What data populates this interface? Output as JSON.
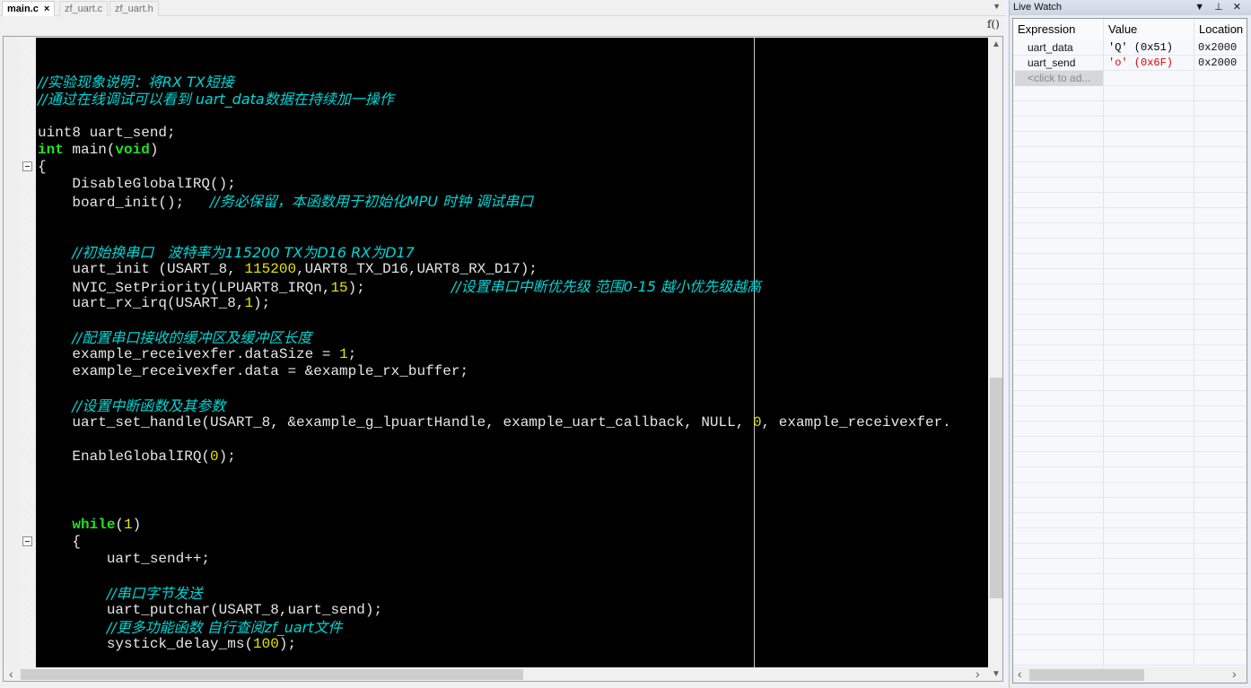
{
  "tabs": [
    {
      "label": "main.c",
      "active": true,
      "close_icon": "×"
    },
    {
      "label": "zf_uart.c",
      "active": false
    },
    {
      "label": "zf_uart.h",
      "active": false
    }
  ],
  "toolbar": {
    "tab_dropdown_icon": "▼",
    "function_icon": "f()"
  },
  "editor": {
    "lines": [
      {
        "segments": [
          {
            "t": "//实验现象说明：将RX TX短接",
            "c": "cm"
          }
        ]
      },
      {
        "segments": [
          {
            "t": "//通过在线调试可以看到 uart_data数据在持续加一操作",
            "c": "cm"
          }
        ]
      },
      {
        "segments": []
      },
      {
        "segments": [
          {
            "t": "uint8 uart_send;",
            "c": ""
          }
        ]
      },
      {
        "segments": [
          {
            "t": "int",
            "c": "kw"
          },
          {
            "t": " main(",
            "c": ""
          },
          {
            "t": "void",
            "c": "kw"
          },
          {
            "t": ")",
            "c": ""
          }
        ]
      },
      {
        "segments": [
          {
            "t": "{",
            "c": ""
          }
        ],
        "fold": true
      },
      {
        "segments": [
          {
            "t": "    DisableGlobalIRQ();",
            "c": ""
          }
        ]
      },
      {
        "segments": [
          {
            "t": "    board_init();   ",
            "c": ""
          },
          {
            "t": "//务必保留，本函数用于初始化MPU 时钟 调试串口",
            "c": "cm"
          }
        ]
      },
      {
        "segments": []
      },
      {
        "segments": []
      },
      {
        "segments": [
          {
            "t": "    ",
            "c": ""
          },
          {
            "t": "//初始换串口   波特率为115200 TX为D16 RX为D17",
            "c": "cm"
          }
        ]
      },
      {
        "segments": [
          {
            "t": "    uart_init (USART_8, ",
            "c": ""
          },
          {
            "t": "115200",
            "c": "num"
          },
          {
            "t": ",UART8_TX_D16,UART8_RX_D17);",
            "c": ""
          }
        ]
      },
      {
        "segments": [
          {
            "t": "    NVIC_SetPriority(LPUART8_IRQn,",
            "c": ""
          },
          {
            "t": "15",
            "c": "num"
          },
          {
            "t": ");          ",
            "c": ""
          },
          {
            "t": "//设置串口中断优先级 范围0-15 越小优先级越高",
            "c": "cm"
          }
        ]
      },
      {
        "segments": [
          {
            "t": "    uart_rx_irq(USART_8,",
            "c": ""
          },
          {
            "t": "1",
            "c": "num"
          },
          {
            "t": ");",
            "c": ""
          }
        ]
      },
      {
        "segments": []
      },
      {
        "segments": [
          {
            "t": "    ",
            "c": ""
          },
          {
            "t": "//配置串口接收的缓冲区及缓冲区长度",
            "c": "cm"
          }
        ]
      },
      {
        "segments": [
          {
            "t": "    example_receivexfer.dataSize = ",
            "c": ""
          },
          {
            "t": "1",
            "c": "num"
          },
          {
            "t": ";",
            "c": ""
          }
        ]
      },
      {
        "segments": [
          {
            "t": "    example_receivexfer.data = &example_rx_buffer;",
            "c": ""
          }
        ]
      },
      {
        "segments": []
      },
      {
        "segments": [
          {
            "t": "    ",
            "c": ""
          },
          {
            "t": "//设置中断函数及其参数",
            "c": "cm"
          }
        ]
      },
      {
        "segments": [
          {
            "t": "    uart_set_handle(USART_8, &example_g_lpuartHandle, example_uart_callback, NULL, ",
            "c": ""
          },
          {
            "t": "0",
            "c": "num"
          },
          {
            "t": ", example_receivexfer.",
            "c": ""
          }
        ]
      },
      {
        "segments": []
      },
      {
        "segments": [
          {
            "t": "    EnableGlobalIRQ(",
            "c": ""
          },
          {
            "t": "0",
            "c": "num"
          },
          {
            "t": ");",
            "c": ""
          }
        ]
      },
      {
        "segments": []
      },
      {
        "segments": []
      },
      {
        "segments": []
      },
      {
        "segments": [
          {
            "t": "    ",
            "c": ""
          },
          {
            "t": "while",
            "c": "kw"
          },
          {
            "t": "(",
            "c": ""
          },
          {
            "t": "1",
            "c": "num"
          },
          {
            "t": ")",
            "c": ""
          }
        ]
      },
      {
        "segments": [
          {
            "t": "    {",
            "c": ""
          }
        ],
        "fold": true
      },
      {
        "segments": [
          {
            "t": "        uart_send++;",
            "c": ""
          }
        ]
      },
      {
        "segments": []
      },
      {
        "segments": [
          {
            "t": "        ",
            "c": ""
          },
          {
            "t": "//串口字节发送",
            "c": "cm"
          }
        ]
      },
      {
        "segments": [
          {
            "t": "        uart_putchar(USART_8,uart_send);",
            "c": ""
          }
        ]
      },
      {
        "segments": [
          {
            "t": "        ",
            "c": ""
          },
          {
            "t": "//更多功能函数 自行查阅zf_uart文件",
            "c": "cm"
          }
        ]
      },
      {
        "segments": [
          {
            "t": "        systick_delay_ms(",
            "c": ""
          },
          {
            "t": "100",
            "c": "num"
          },
          {
            "t": ");",
            "c": ""
          }
        ]
      }
    ]
  },
  "scrollbars": {
    "up_icon": "▲",
    "down_icon": "▼",
    "left_icon": "‹",
    "right_icon": "›"
  },
  "live_watch": {
    "title": "Live Watch",
    "controls": "▼ ⊥ ✕",
    "columns": [
      "Expression",
      "Value",
      "Location"
    ],
    "rows": [
      {
        "expression": "uart_data",
        "value": "'Q' (0x51)",
        "location": "0x2000",
        "value_color": "#000000"
      },
      {
        "expression": "uart_send",
        "value": "'o' (0x6F)",
        "location": "0x2000",
        "value_color": "#e00000"
      }
    ],
    "add_placeholder": "<click to ad..."
  }
}
